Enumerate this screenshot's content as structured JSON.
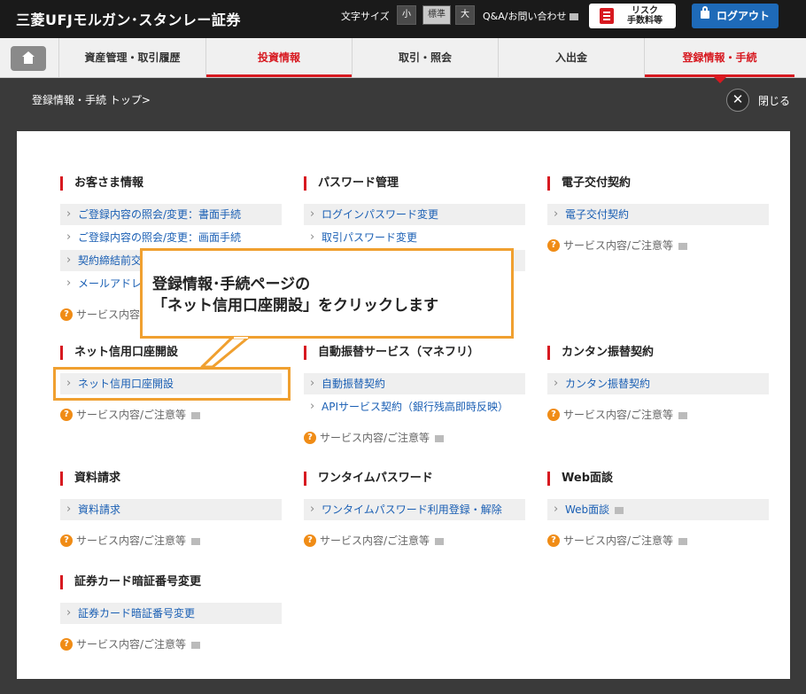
{
  "header": {
    "logo": "三菱UFJモルガン･スタンレー証券",
    "font_size_label": "文字サイズ",
    "font_sizes": [
      "小",
      "標準",
      "大"
    ],
    "qa_link": "Q&A/お問い合わせ",
    "risk_button": "リスク\n手数料等",
    "logout": "ログアウト"
  },
  "nav": {
    "home_icon": "home-icon",
    "tabs": [
      "資産管理・取引履歴",
      "投資情報",
      "取引・照会",
      "入出金",
      "登録情報・手続"
    ]
  },
  "breadcrumb": "登録情報・手続 トップ>",
  "close_label": "閉じる",
  "notice_text": "サービス内容/ご注意等",
  "sections": [
    {
      "title": "お客さま情報",
      "links": [
        "ご登録内容の照会/変更：書面手続",
        "ご登録内容の照会/変更：画面手続",
        "契約締結前交付書面",
        "メールアドレス登録"
      ]
    },
    {
      "title": "パスワード管理",
      "links": [
        "ログインパスワード変更",
        "取引パスワード変更",
        ""
      ]
    },
    {
      "title": "電子交付契約",
      "links": [
        "電子交付契約"
      ]
    },
    {
      "title": "ネット信用口座開設",
      "links": [
        "ネット信用口座開設"
      ]
    },
    {
      "title": "自動振替サービス（マネフリ）",
      "links": [
        "自動振替契約",
        "APIサービス契約（銀行残高即時反映）"
      ]
    },
    {
      "title": "カンタン振替契約",
      "links": [
        "カンタン振替契約"
      ]
    },
    {
      "title": "資料請求",
      "links": [
        "資料請求"
      ]
    },
    {
      "title": "ワンタイムパスワード",
      "links": [
        "ワンタイムパスワード利用登録・解除"
      ]
    },
    {
      "title": "Web面談",
      "links": [
        "Web面談"
      ]
    },
    {
      "title": "証券カード暗証番号変更",
      "links": [
        "証券カード暗証番号変更"
      ]
    }
  ],
  "callout": {
    "text": "登録情報･手続ページの\n「ネット信用口座開設」をクリックします"
  },
  "colors": {
    "accent": "#d71920",
    "link": "#1a5fb4",
    "callout": "#f0a030",
    "logout": "#1e6ab8"
  }
}
